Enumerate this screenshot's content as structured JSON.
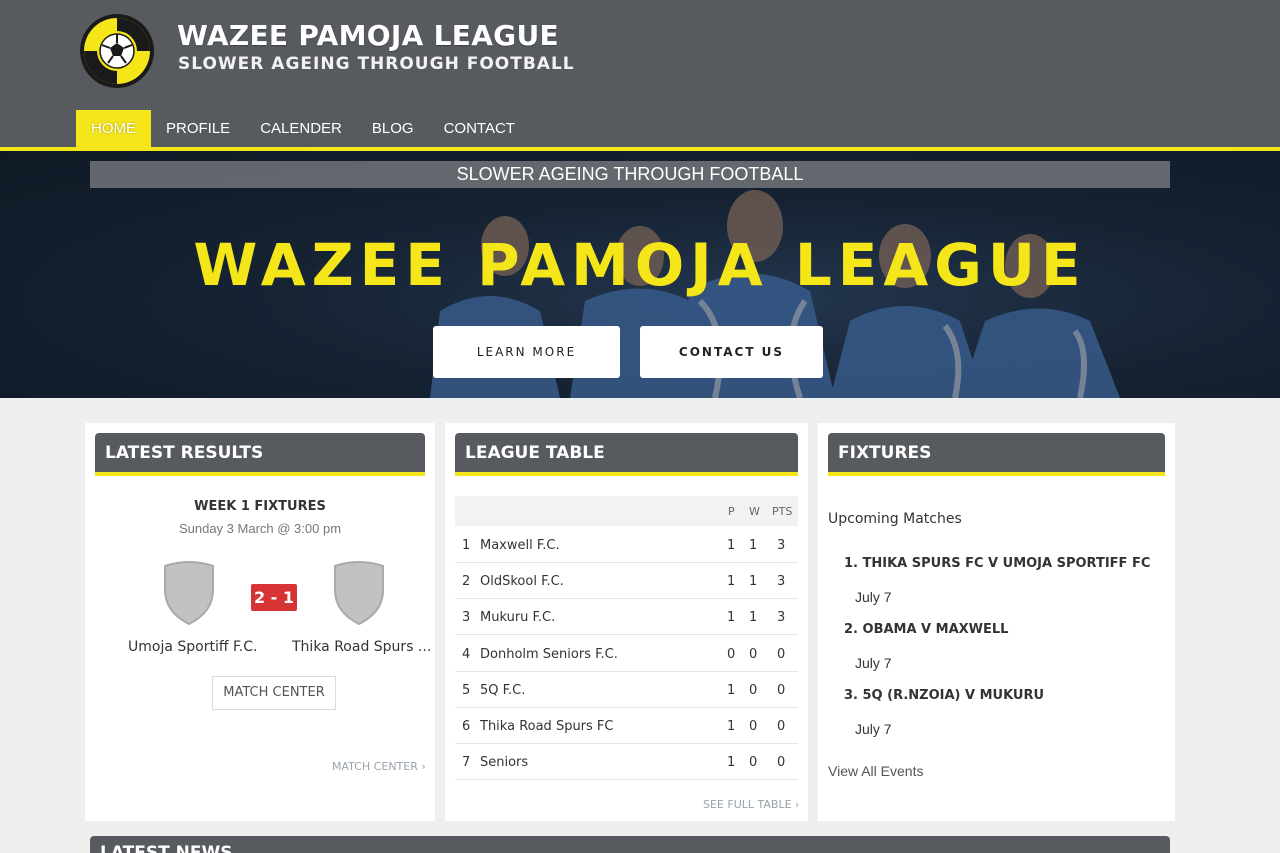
{
  "site": {
    "title": "WAZEE PAMOJA LEAGUE",
    "tagline": "SLOWER AGEING THROUGH FOOTBALL"
  },
  "nav": {
    "items": [
      {
        "label": "HOME",
        "active": true
      },
      {
        "label": "PROFILE"
      },
      {
        "label": "CALENDER"
      },
      {
        "label": "BLOG"
      },
      {
        "label": "CONTACT"
      }
    ]
  },
  "hero": {
    "strip": "SLOWER AGEING THROUGH FOOTBALL",
    "title": "WAZEE PAMOJA LEAGUE",
    "learn_more": "LEARN MORE",
    "contact_us": "CONTACT US"
  },
  "results": {
    "heading": "LATEST RESULTS",
    "week": "WEEK 1 FIXTURES",
    "date": "Sunday 3 March @ 3:00 pm",
    "score": "2 - 1",
    "home_team": "Umoja Sportiff F.C.",
    "away_team": "Thika Road Spurs ...",
    "match_center_button": "MATCH CENTER",
    "match_center_link": "MATCH CENTER"
  },
  "league_table": {
    "heading": "LEAGUE TABLE",
    "columns": [
      "P",
      "W",
      "PTS"
    ],
    "rows": [
      {
        "pos": "1",
        "team": "Maxwell F.C.",
        "p": "1",
        "w": "1",
        "pts": "3"
      },
      {
        "pos": "2",
        "team": "OldSkool F.C.",
        "p": "1",
        "w": "1",
        "pts": "3"
      },
      {
        "pos": "3",
        "team": "Mukuru F.C.",
        "p": "1",
        "w": "1",
        "pts": "3"
      },
      {
        "pos": "4",
        "team": "Donholm Seniors F.C.",
        "p": "0",
        "w": "0",
        "pts": "0"
      },
      {
        "pos": "5",
        "team": "5Q F.C.",
        "p": "1",
        "w": "0",
        "pts": "0"
      },
      {
        "pos": "6",
        "team": "Thika Road Spurs FC",
        "p": "1",
        "w": "0",
        "pts": "0"
      },
      {
        "pos": "7",
        "team": "Seniors",
        "p": "1",
        "w": "0",
        "pts": "0"
      }
    ],
    "see_full_table": "SEE FULL TABLE"
  },
  "fixtures": {
    "heading": "FIXTURES",
    "subheading": "Upcoming Matches",
    "items": [
      {
        "number": "1.",
        "match": "THIKA SPURS FC V UMOJA SPORTIFF FC",
        "date": "July 7"
      },
      {
        "number": "2.",
        "match": "OBAMA V MAXWELL",
        "date": "July 7"
      },
      {
        "number": "3.",
        "match": "5Q (R.NZOIA) V MUKURU",
        "date": "July 7"
      }
    ],
    "view_all": "View All Events"
  },
  "news": {
    "heading": "LATEST NEWS"
  },
  "colors": {
    "accent": "#f5e61a",
    "header": "#575b60",
    "score_badge": "#d63434"
  }
}
